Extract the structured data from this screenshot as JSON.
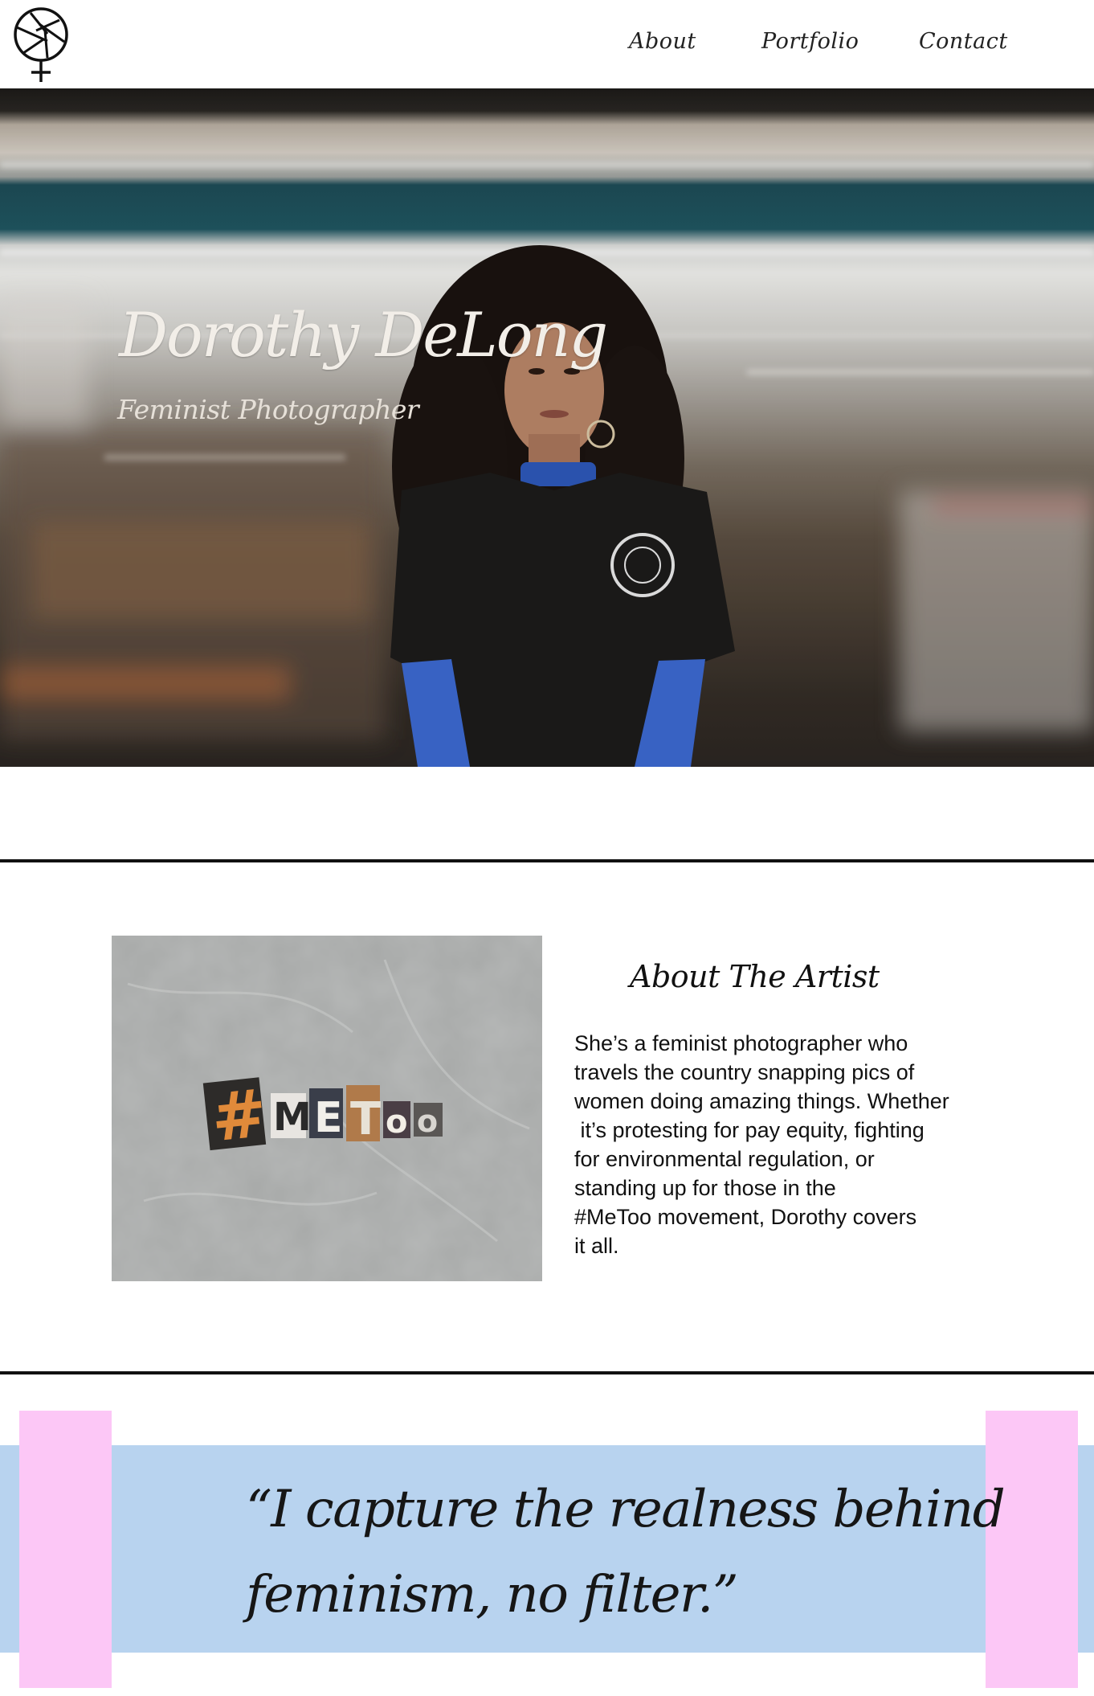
{
  "nav": {
    "about": "About",
    "portfolio": "Portfolio",
    "contact": "Contact"
  },
  "hero": {
    "title": "Dorothy DeLong",
    "subtitle": "Feminist Photographer"
  },
  "about": {
    "heading": "About The Artist",
    "image_text": "#MeToo",
    "body_lines": [
      "She’s a feminist photographer who",
      "travels the country snapping pics of",
      "women doing amazing things. Whether",
      " it’s protesting for pay equity, fighting",
      "for environmental regulation, or",
      "standing up for those in the",
      "#MeToo movement, Dorothy covers",
      "it all."
    ]
  },
  "quote": {
    "lines": [
      "“I capture the realness behind",
      "feminism, no filter.”"
    ]
  },
  "colors": {
    "quote_band": "#b8d3ef",
    "pink_accent": "#fcc7f6",
    "divider": "#111111"
  },
  "icons": {
    "logo": "camera-aperture-venus-icon"
  }
}
